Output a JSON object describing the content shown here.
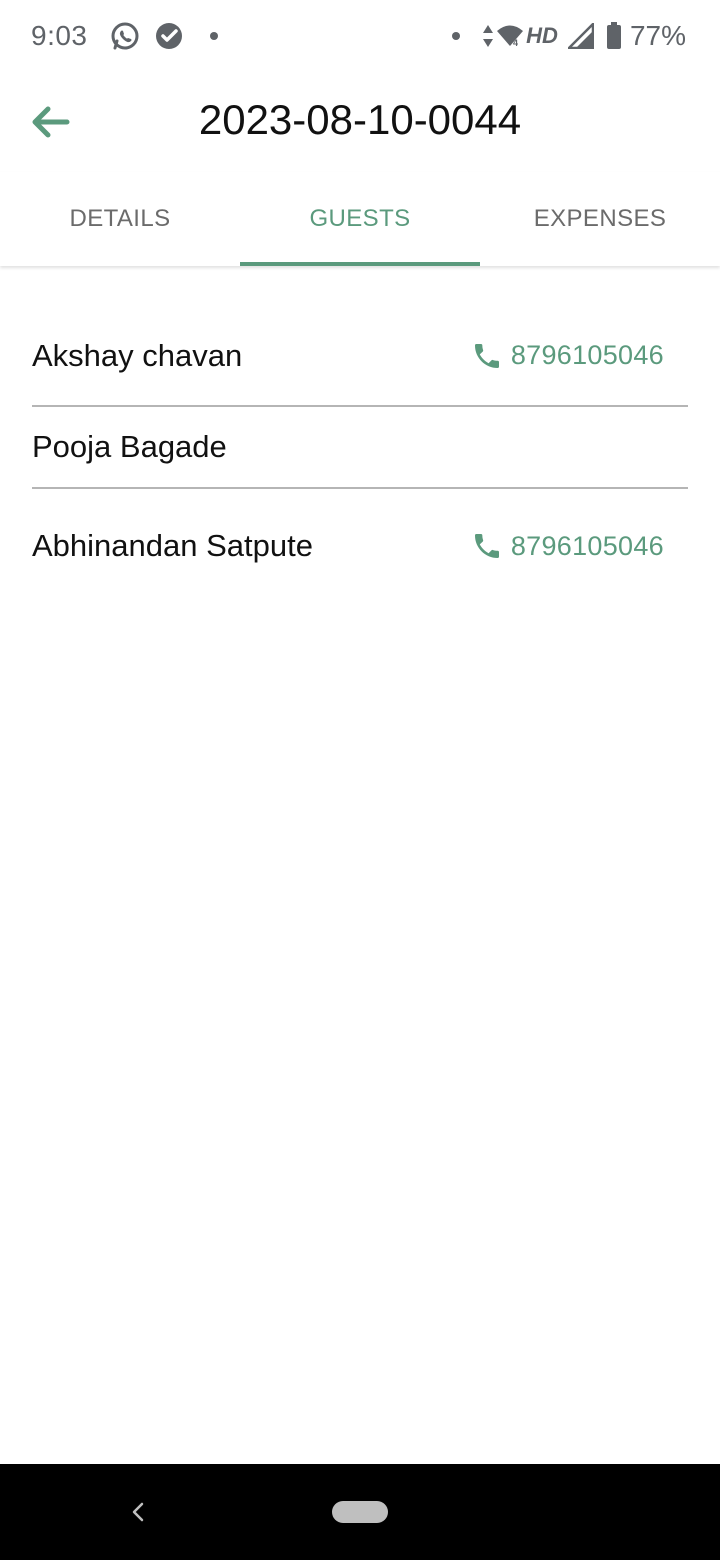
{
  "status_bar": {
    "time": "9:03",
    "network_label": "HD",
    "battery": "77%",
    "icons": [
      "whatsapp-icon",
      "check-circle-icon",
      "notification-dot",
      "data-arrows-icon",
      "wifi-icon",
      "signal-icon",
      "battery-icon"
    ]
  },
  "header": {
    "title": "2023-08-10-0044",
    "back_icon": "arrow-left-icon"
  },
  "tabs": [
    {
      "label": "DETAILS",
      "active": false
    },
    {
      "label": "GUESTS",
      "active": true
    },
    {
      "label": "EXPENSES",
      "active": false
    }
  ],
  "guests": [
    {
      "name": "Akshay chavan",
      "phone": "8796105046"
    },
    {
      "name": "Pooja Bagade",
      "phone": ""
    },
    {
      "name": "Abhinandan Satpute",
      "phone": "8796105046"
    }
  ],
  "colors": {
    "accent": "#5b9a7d",
    "status_text": "#5f6368",
    "divider": "#b5b5b5",
    "nav_bar": "#000000"
  }
}
